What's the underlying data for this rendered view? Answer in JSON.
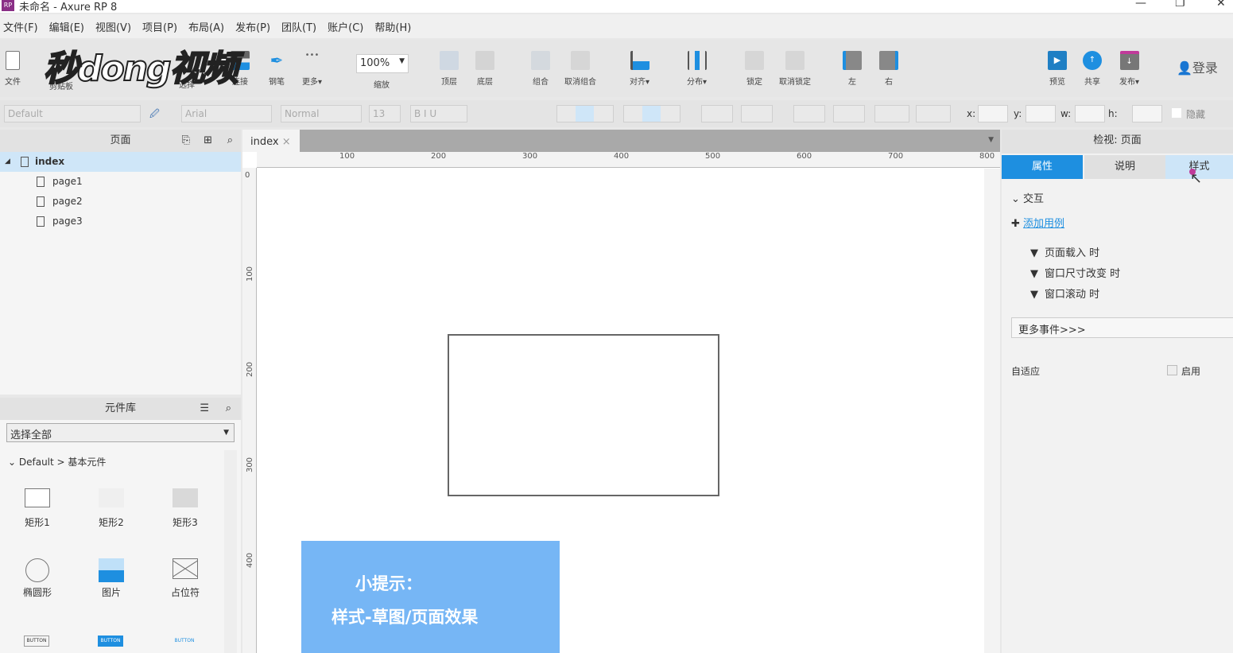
{
  "window": {
    "logo": "RP",
    "title": "未命名 - Axure RP 8"
  },
  "menu": [
    "文件(F)",
    "编辑(E)",
    "视图(V)",
    "项目(P)",
    "布局(A)",
    "发布(P)",
    "团队(T)",
    "账户(C)",
    "帮助(H)"
  ],
  "watermark": "秒dong视频",
  "toolbar": {
    "file": "文件",
    "clipboard": "剪贴板",
    "select": "选择",
    "connect": "连接",
    "pen": "钢笔",
    "more": "更多▾",
    "zoom": "100%",
    "zoom_label": "缩放",
    "top": "顶层",
    "bottom": "底层",
    "group": "组合",
    "ungroup": "取消组合",
    "align": "对齐▾",
    "distribute": "分布▾",
    "lock": "锁定",
    "unlock": "取消锁定",
    "left": "左",
    "right": "右",
    "preview": "预览",
    "share": "共享",
    "publish": "发布▾",
    "login": "登录"
  },
  "format": {
    "style": "Default",
    "font": "Arial",
    "weight": "Normal",
    "size": "13",
    "x": "x:",
    "y": "y:",
    "w": "w:",
    "h": "h:",
    "hide": "隐藏"
  },
  "pages": {
    "title": "页面",
    "items": [
      "index",
      "page1",
      "page2",
      "page3"
    ]
  },
  "library": {
    "title": "元件库",
    "select": "选择全部",
    "group": "Default > 基本元件",
    "widgets": [
      "矩形1",
      "矩形2",
      "矩形3",
      "椭圆形",
      "图片",
      "占位符"
    ],
    "buttons": [
      "BUTTON",
      "BUTTON",
      "BUTTON"
    ]
  },
  "canvas": {
    "tab": "index",
    "hticks": [
      "100",
      "200",
      "300",
      "400",
      "500",
      "600",
      "700",
      "800"
    ],
    "vticks": [
      "0",
      "100",
      "200",
      "300",
      "400"
    ],
    "tip1": "小提示：",
    "tip2": "样式-草图/页面效果"
  },
  "inspector": {
    "title": "检视: 页面",
    "tabs": [
      "属性",
      "说明",
      "样式"
    ],
    "section": "交互",
    "add_case": "添加用例",
    "events": [
      "页面载入 时",
      "窗口尺寸改变 时",
      "窗口滚动 时"
    ],
    "more_events": "更多事件>>>",
    "adaptive": "自适应",
    "enable": "启用"
  }
}
